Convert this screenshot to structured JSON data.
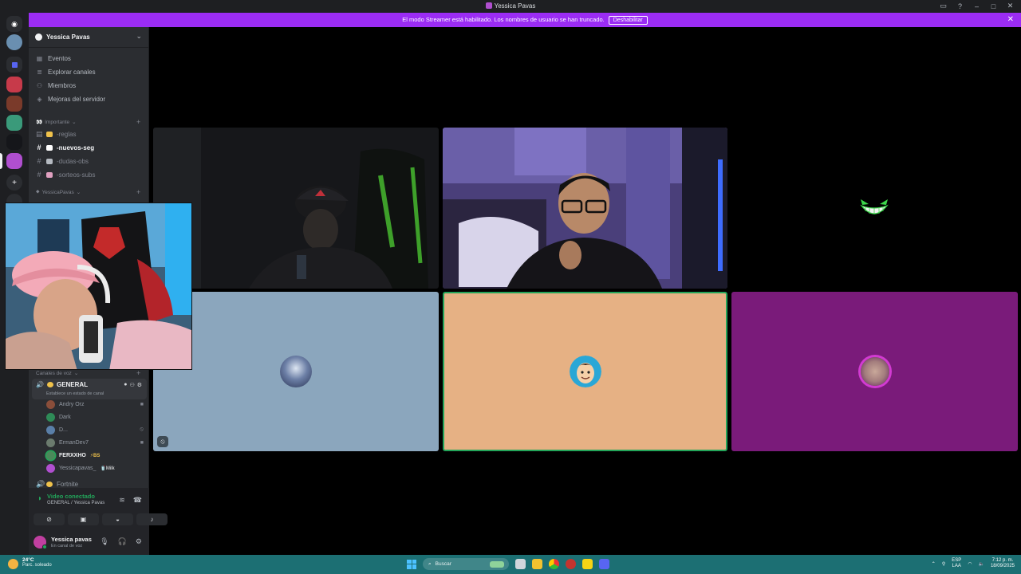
{
  "window": {
    "title": "Yessica Pavas"
  },
  "banner": {
    "message": "El modo Streamer está habilitado. Los nombres de usuario se han truncado.",
    "button": "Deshabilitar"
  },
  "server": {
    "name": "Yessica Pavas",
    "nav": [
      {
        "icon": "calendar-icon",
        "label": "Eventos"
      },
      {
        "icon": "compass-icon",
        "label": "Explorar canales"
      },
      {
        "icon": "members-icon",
        "label": "Miembros"
      },
      {
        "icon": "boost-icon",
        "label": "Mejoras del servidor"
      }
    ]
  },
  "categories": {
    "importante": "Importante",
    "yessica": "YessicaPavas",
    "voice": "Canales de voz"
  },
  "text_channels": [
    {
      "label": "-reglas",
      "emoji_color": "#f0c24b",
      "active": false
    },
    {
      "label": "-nuevos-seg",
      "emoji_color": "#ffffff",
      "active": true
    },
    {
      "label": "-dudas-obs",
      "emoji_color": "#b5bac1",
      "active": false
    },
    {
      "label": "-sorteos-subs",
      "emoji_color": "#e0a0c0",
      "active": false
    }
  ],
  "voice_channel": {
    "name": "GENERAL",
    "status_hint": "Establece un estado de canal",
    "members": [
      {
        "name": "Andry Orz",
        "color": "#8a4e3a",
        "status_icon": "camera-icon",
        "speaking": false
      },
      {
        "name": "Dark",
        "color": "#2e8b57",
        "status_icon": "",
        "speaking": false
      },
      {
        "name": "D...",
        "color": "#5a7fa8",
        "status_icon": "deafened-icon",
        "speaking": false
      },
      {
        "name": "ErmanDev7",
        "color": "#6b7b6e",
        "status_icon": "camera-icon",
        "speaking": false
      },
      {
        "name": "FERXXHO",
        "badge": "⚡BS",
        "color": "#4a8a5a",
        "status_icon": "",
        "speaking": true
      },
      {
        "name": "Yessicapavas_",
        "badge": "🥤Milk",
        "color": "#b04fcf",
        "status_icon": "",
        "speaking": false
      }
    ]
  },
  "other_voice_channel": {
    "name": "Fortnite"
  },
  "voice_panel": {
    "status": "Video conectado",
    "location": "GENERAL / Yessica Pavas"
  },
  "user": {
    "name": "Yessica pavas",
    "status": "En canal de voz"
  },
  "tiles": [
    {
      "kind": "video",
      "scene": "cap-gamer",
      "bg": "#17181a"
    },
    {
      "kind": "video",
      "scene": "glasses-room",
      "bg": "#2a2440"
    },
    {
      "kind": "avatar",
      "bg": "#000000",
      "avatar": "grin-icon"
    },
    {
      "kind": "avatar",
      "bg": "#8ba6bd",
      "avatar": "anime-avatar"
    },
    {
      "kind": "avatar",
      "bg": "#e6b184",
      "avatar": "cartoon-face",
      "speaking": true
    },
    {
      "kind": "avatar",
      "bg": "#7a1b7a",
      "avatar": "photo-avatar"
    }
  ],
  "taskbar": {
    "temperature": "24°C",
    "weather": "Parc. soleado",
    "search_placeholder": "Buscar",
    "lang_top": "ESP",
    "lang_bottom": "LAA",
    "time": "7:12 p. m.",
    "date": "18/09/2025"
  }
}
